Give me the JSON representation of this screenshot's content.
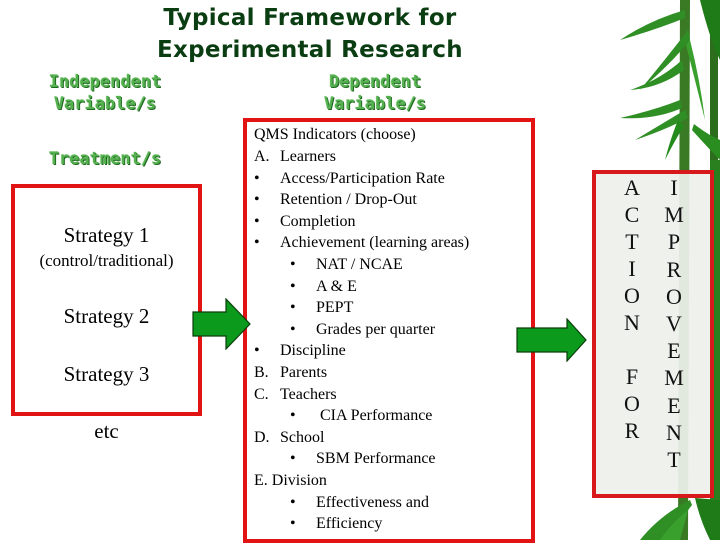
{
  "title": {
    "line1": "Typical Framework for",
    "line2": "Experimental Research"
  },
  "headings": {
    "independent_line1": "Independent",
    "independent_line2": "Variable/s",
    "dependent_line1": "Dependent",
    "dependent_line2": "Variable/s",
    "treatment": "Treatment/s"
  },
  "strategies": [
    {
      "label": "Strategy 1",
      "sub": "(control/traditional)"
    },
    {
      "label": "Strategy 2"
    },
    {
      "label": "Strategy 3"
    },
    {
      "label": "etc"
    }
  ],
  "indicators": {
    "heading": "QMS Indicators (choose)",
    "lines": [
      {
        "marker": "A.",
        "text": "Learners",
        "level": 0
      },
      {
        "marker": "•",
        "text": "Access/Participation Rate",
        "level": 1
      },
      {
        "marker": "•",
        "text": "Retention / Drop-Out",
        "level": 1
      },
      {
        "marker": "•",
        "text": "Completion",
        "level": 1
      },
      {
        "marker": "•",
        "text": "Achievement (learning areas)",
        "level": 1
      },
      {
        "marker": "•",
        "text": "NAT / NCAE",
        "level": 2
      },
      {
        "marker": "•",
        "text": "A & E",
        "level": 2
      },
      {
        "marker": "•",
        "text": "PEPT",
        "level": 2
      },
      {
        "marker": "•",
        "text": "Grades per quarter",
        "level": 2
      },
      {
        "marker": "•",
        "text": "Discipline",
        "level": 1
      },
      {
        "marker": "B.",
        "text": "Parents",
        "level": 0
      },
      {
        "marker": "C.",
        "text": "Teachers",
        "level": 0
      },
      {
        "marker": "•",
        "text": " CIA Performance",
        "level": 2
      },
      {
        "marker": "D.",
        "text": "School",
        "level": 0
      },
      {
        "marker": "•",
        "text": "SBM Performance",
        "level": 2
      },
      {
        "marker": "E.",
        "text": "Division",
        "level": 3
      },
      {
        "marker": "•",
        "text": "Effectiveness and",
        "level": 2
      },
      {
        "marker": "•",
        "text": "Efficiency",
        "level": 2
      }
    ]
  },
  "outcome": {
    "left_column": [
      "A",
      "C",
      "T",
      "I",
      "O",
      "N",
      "",
      "F",
      "O",
      "R"
    ],
    "right_column": [
      "I",
      "M",
      "P",
      "R",
      "O",
      "V",
      "E",
      "M",
      "E",
      "N",
      "T"
    ],
    "left_word": "ACTION FOR",
    "right_word": "IMPROVEMENT"
  },
  "colors": {
    "title": "#0b3d12",
    "heading_green": "#55b04f",
    "box_border": "#e21313",
    "arrow_fill": "#0b9a1b",
    "arrow_stroke": "#0a3d0a"
  }
}
